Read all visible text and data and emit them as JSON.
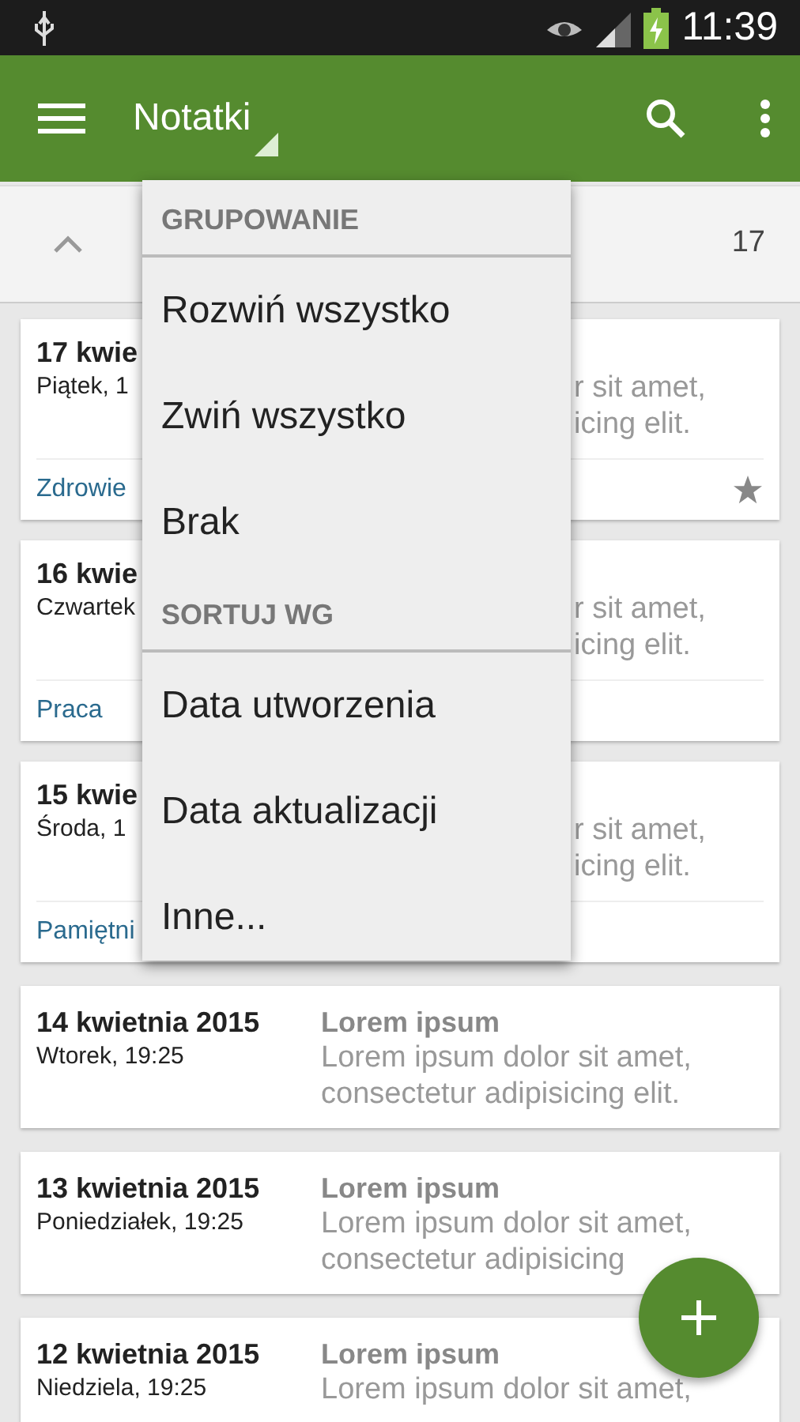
{
  "status_bar": {
    "time": "11:39"
  },
  "app_bar": {
    "title": "Notatki"
  },
  "group_header": {
    "expanded": true,
    "count": "17"
  },
  "notes": [
    {
      "kind": "partial",
      "date": "17 kwie",
      "time": "Piątek, 1",
      "line_1": "r sit amet,",
      "line_2": "icing elit.",
      "tag": "Zdrowie",
      "starred": true
    },
    {
      "kind": "partial",
      "date": "16 kwie",
      "time": "Czwartek",
      "line_1": "r sit amet,",
      "line_2": "icing elit.",
      "tag": "Praca",
      "starred": false
    },
    {
      "kind": "partial",
      "date": "15 kwie",
      "time": "Środa, 1",
      "line_1": "r sit amet,",
      "line_2": "icing elit.",
      "tag": "Pamiętni",
      "starred": false
    },
    {
      "kind": "full",
      "date": "14 kwietnia 2015",
      "time": "Wtorek, 19:25",
      "title": "Lorem ipsum",
      "line_1": "Lorem ipsum dolor sit amet,",
      "line_2": "consectetur adipisicing elit."
    },
    {
      "kind": "full",
      "date": "13 kwietnia 2015",
      "time": "Poniedziałek, 19:25",
      "title": "Lorem ipsum",
      "line_1": "Lorem ipsum dolor sit amet,",
      "line_2": "consectetur adipisicing"
    },
    {
      "kind": "full",
      "date": "12 kwietnia 2015",
      "time": "Niedziela, 19:25",
      "title": "Lorem ipsum",
      "line_1": "Lorem ipsum dolor sit amet,"
    }
  ],
  "menu": {
    "sections": [
      {
        "header": "GRUPOWANIE",
        "items": [
          "Rozwiń wszystko",
          "Zwiń wszystko",
          "Brak"
        ]
      },
      {
        "header": "SORTUJ WG",
        "items": [
          "Data utworzenia",
          "Data aktualizacji",
          "Inne..."
        ]
      }
    ]
  }
}
